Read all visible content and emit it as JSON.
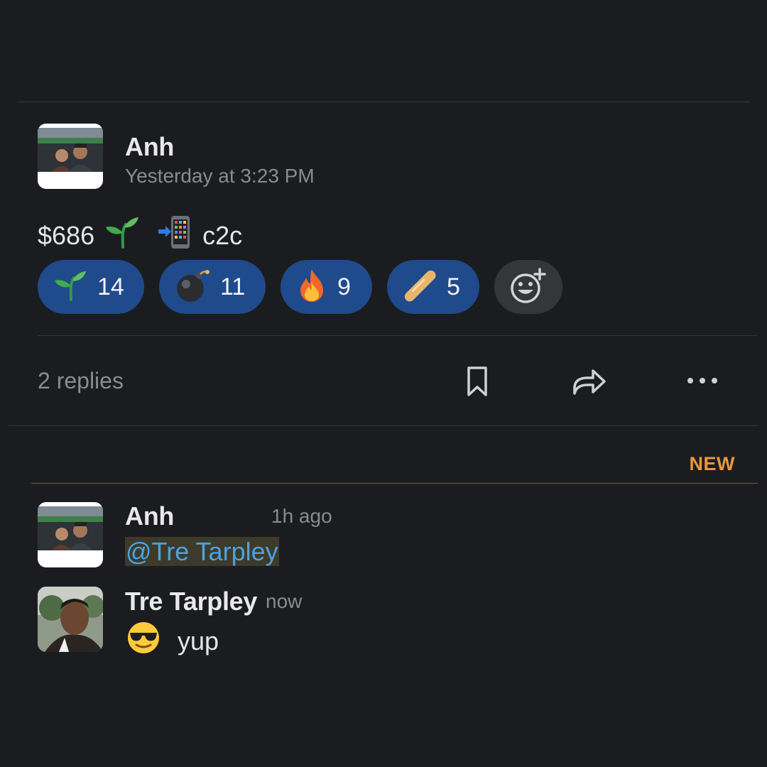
{
  "post": {
    "author": "Anh",
    "timestamp": "Yesterday at 3:23 PM",
    "amount_text": "$686",
    "suffix_text": "c2c",
    "inline_icons": [
      "seedling-emoji",
      "mobile-arrow-emoji"
    ]
  },
  "reactions": [
    {
      "icon": "seedling-emoji",
      "count": "14"
    },
    {
      "icon": "bomb-emoji",
      "count": "11"
    },
    {
      "icon": "fire-emoji",
      "count": "9"
    },
    {
      "icon": "baguette-emoji",
      "count": "5"
    }
  ],
  "add_reaction_icon": "add-reaction-icon",
  "thread_bar": {
    "replies_text": "2 replies",
    "actions": [
      "bookmark-icon",
      "share-icon",
      "more-icon"
    ]
  },
  "new_label": "NEW",
  "replies": [
    {
      "author": "Anh",
      "time": "1h ago",
      "text": "@Tre Tarpley"
    },
    {
      "author": "Tre Tarpley",
      "time": "now",
      "text": "yup",
      "icon": "sunglasses-emoji"
    }
  ],
  "colors": {
    "background": "#1b1c1f",
    "reaction_bg": "#1f4a8c",
    "new_accent": "#e8973e",
    "mention_text": "#4aa3e0"
  }
}
